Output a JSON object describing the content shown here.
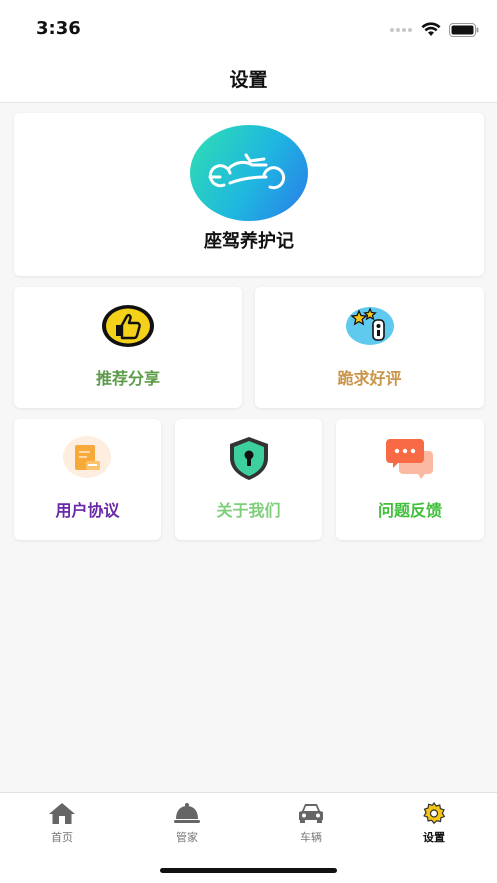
{
  "status_bar": {
    "time": "3:36"
  },
  "nav": {
    "title": "设置"
  },
  "app": {
    "name": "座驾养护记"
  },
  "tiles": {
    "recommend": {
      "label": "推荐分享",
      "color": "#5d9b4a"
    },
    "rate": {
      "label": "跪求好评",
      "color": "#c9954a"
    },
    "agreement": {
      "label": "用户协议",
      "color": "#6a2aa8"
    },
    "about": {
      "label": "关于我们",
      "color": "#7fcf7a"
    },
    "feedback": {
      "label": "问题反馈",
      "color": "#3fbf3a"
    }
  },
  "tab_bar": {
    "items": [
      {
        "label": "首页",
        "icon": "home-icon"
      },
      {
        "label": "管家",
        "icon": "butler-bell-icon"
      },
      {
        "label": "车辆",
        "icon": "car-icon"
      },
      {
        "label": "设置",
        "icon": "gear-icon",
        "active": true
      }
    ]
  }
}
